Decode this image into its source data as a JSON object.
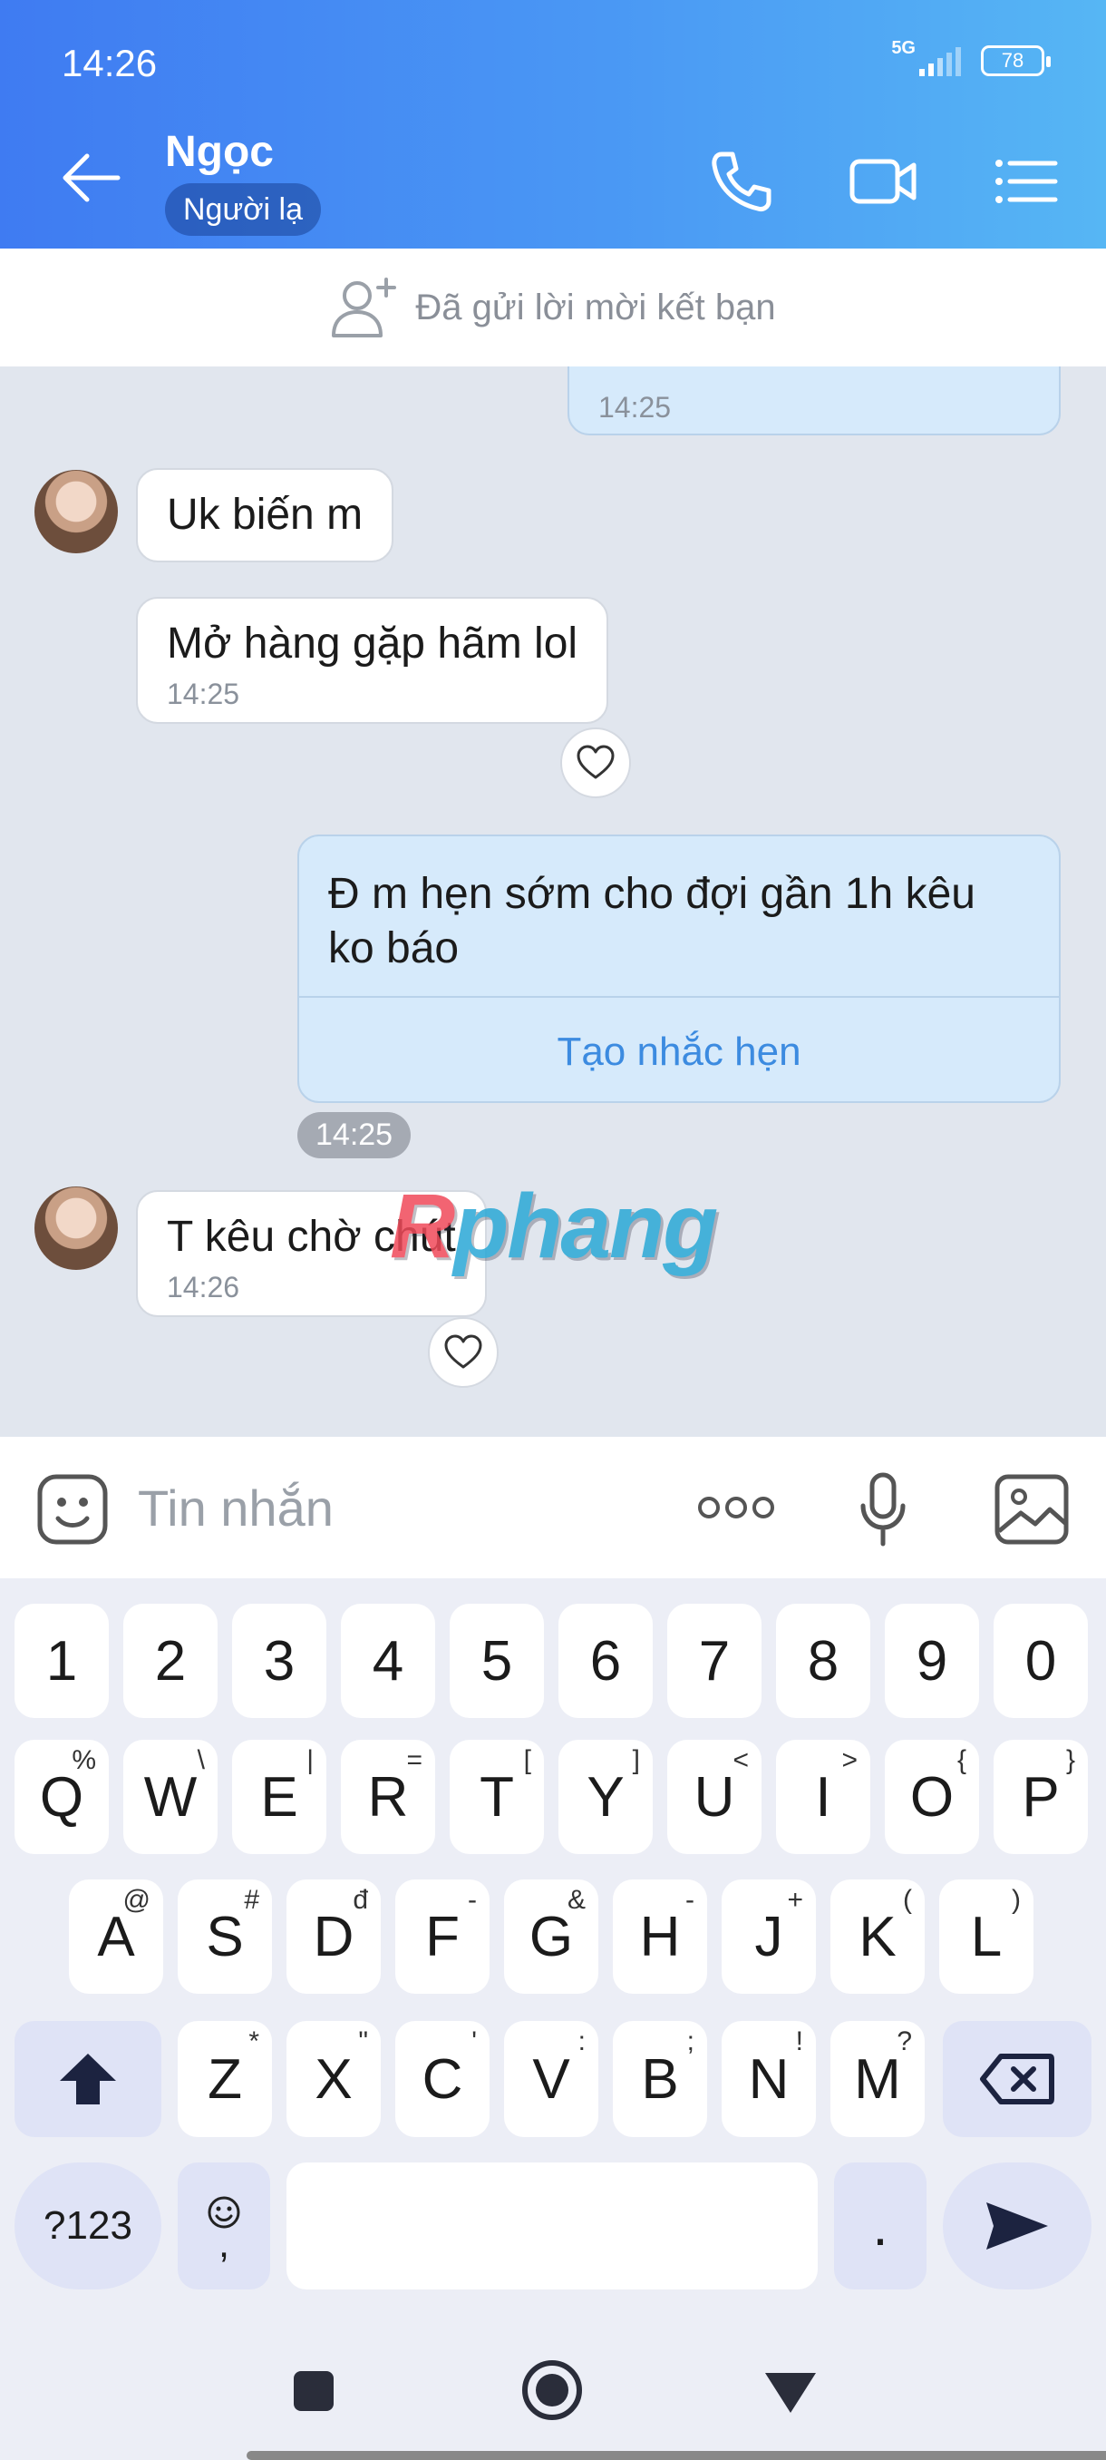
{
  "status_bar": {
    "time": "14:26",
    "network": "5G",
    "battery": "78"
  },
  "header": {
    "contact_name": "Ngọc",
    "badge": "Người lạ"
  },
  "friend_request": {
    "text": "Đã gửi lời mời kết bạn"
  },
  "messages": {
    "m0": {
      "time": "14:25"
    },
    "m1": {
      "text": "Uk biến m"
    },
    "m2": {
      "text": "Mở hàng gặp hãm lol",
      "time": "14:25"
    },
    "m3": {
      "text": "Đ m hẹn sớm cho đợi gần 1h kêu ko báo",
      "reminder_link": "Tạo nhắc hẹn",
      "time": "14:25"
    },
    "m4": {
      "text": "T kêu chờ chút",
      "time": "14:26"
    }
  },
  "watermark": {
    "first": "R",
    "rest": "phang"
  },
  "composer": {
    "placeholder": "Tin nhắn"
  },
  "keyboard": {
    "row1": [
      {
        "k": "1"
      },
      {
        "k": "2"
      },
      {
        "k": "3"
      },
      {
        "k": "4"
      },
      {
        "k": "5"
      },
      {
        "k": "6"
      },
      {
        "k": "7"
      },
      {
        "k": "8"
      },
      {
        "k": "9"
      },
      {
        "k": "0"
      }
    ],
    "row2": [
      {
        "k": "Q",
        "s": "%"
      },
      {
        "k": "W",
        "s": "\\"
      },
      {
        "k": "E",
        "s": "|"
      },
      {
        "k": "R",
        "s": "="
      },
      {
        "k": "T",
        "s": "["
      },
      {
        "k": "Y",
        "s": "]"
      },
      {
        "k": "U",
        "s": "<"
      },
      {
        "k": "I",
        "s": ">"
      },
      {
        "k": "O",
        "s": "{"
      },
      {
        "k": "P",
        "s": "}"
      }
    ],
    "row3": [
      {
        "k": "A",
        "s": "@"
      },
      {
        "k": "S",
        "s": "#"
      },
      {
        "k": "D",
        "s": "đ"
      },
      {
        "k": "F",
        "s": "-"
      },
      {
        "k": "G",
        "s": "&"
      },
      {
        "k": "H",
        "s": "-"
      },
      {
        "k": "J",
        "s": "+"
      },
      {
        "k": "K",
        "s": "("
      },
      {
        "k": "L",
        "s": ")"
      }
    ],
    "row4": [
      {
        "k": "Z",
        "s": "*"
      },
      {
        "k": "X",
        "s": "\""
      },
      {
        "k": "C",
        "s": "'"
      },
      {
        "k": "V",
        "s": ":"
      },
      {
        "k": "B",
        "s": ";"
      },
      {
        "k": "N",
        "s": "!"
      },
      {
        "k": "M",
        "s": "?"
      }
    ],
    "symbols_key": "?123",
    "emoji_key_sub": ",",
    "period_key": "."
  },
  "colors": {
    "header_start": "#3f7bf2",
    "header_end": "#56b6f4",
    "link": "#3c8be0",
    "outgoing_bubble": "#d6eafb"
  }
}
